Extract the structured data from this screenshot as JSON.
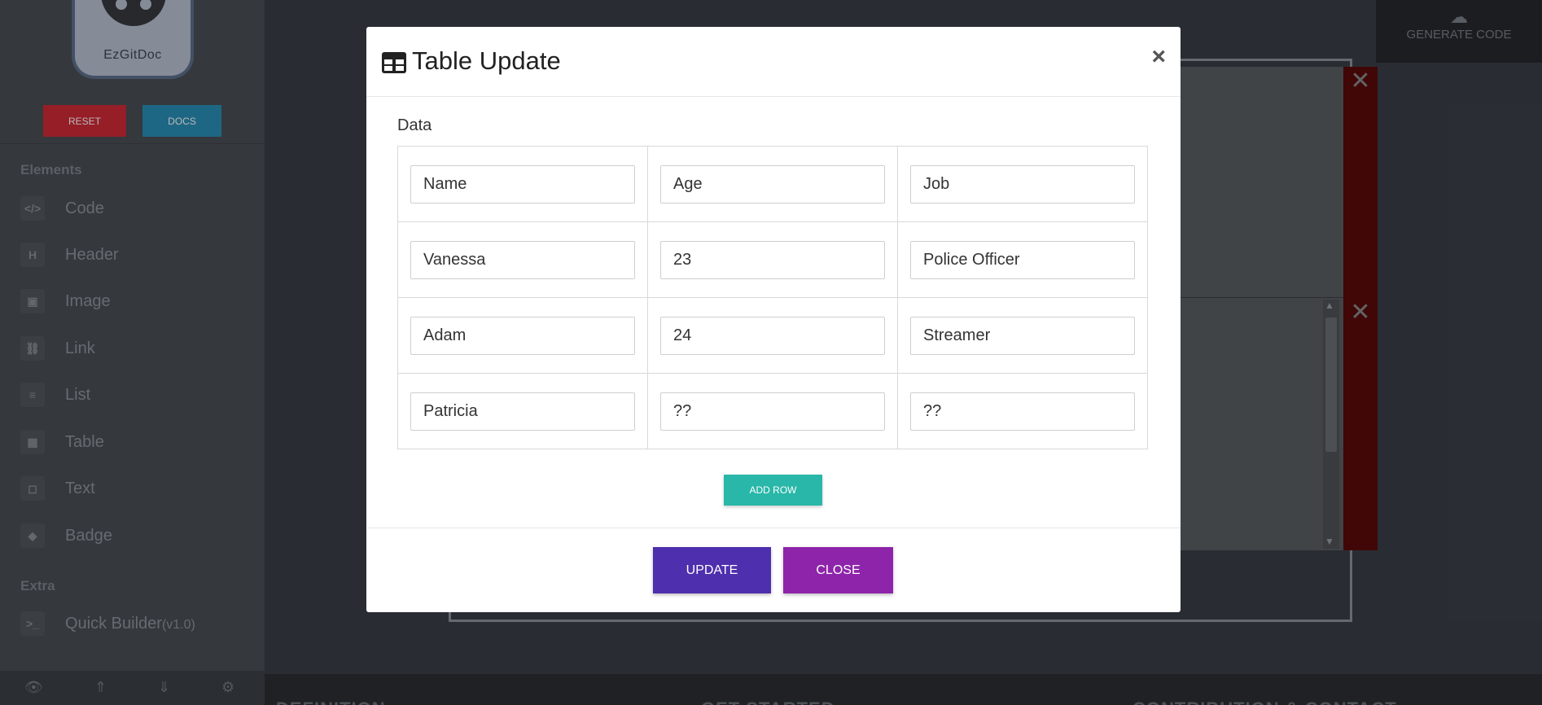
{
  "sidebar": {
    "logo_text": "EzGitDoc",
    "reset_label": "RESET",
    "docs_label": "DOCS",
    "elements_heading": "Elements",
    "items": [
      {
        "label": "Code",
        "icon": "code-icon",
        "glyph": "</>"
      },
      {
        "label": "Header",
        "icon": "header-icon",
        "glyph": "H"
      },
      {
        "label": "Image",
        "icon": "image-icon",
        "glyph": "▣"
      },
      {
        "label": "Link",
        "icon": "link-icon",
        "glyph": "⛓"
      },
      {
        "label": "List",
        "icon": "list-icon",
        "glyph": "≡"
      },
      {
        "label": "Table",
        "icon": "table-icon",
        "glyph": "▦"
      },
      {
        "label": "Text",
        "icon": "text-icon",
        "glyph": "◻"
      },
      {
        "label": "Badge",
        "icon": "badge-icon",
        "glyph": "◆"
      }
    ],
    "extra_heading": "Extra",
    "quick_builder": {
      "label": "Quick Builder",
      "version": "(v1.0)",
      "icon": "terminal-icon",
      "glyph": ">_"
    },
    "footer_icons": [
      "eye-icon",
      "collapse-up-icon",
      "collapse-down-icon",
      "gear-icon"
    ]
  },
  "generate_code": {
    "label": "GENERATE CODE",
    "icon": "cloud-code-icon"
  },
  "bottom_sections": [
    "DEFINITION",
    "GET STARTED",
    "CONTRIBUTION & CONTACT"
  ],
  "modal": {
    "title": "Table Update",
    "title_icon": "table-icon",
    "close_glyph": "×",
    "data_label": "Data",
    "rows": [
      [
        "Name",
        "Age",
        "Job"
      ],
      [
        "Vanessa",
        "23",
        "Police Officer"
      ],
      [
        "Adam",
        "24",
        "Streamer"
      ],
      [
        "Patricia",
        "??",
        "??"
      ]
    ],
    "add_row_label": "ADD ROW",
    "update_label": "UPDATE",
    "close_label": "CLOSE"
  },
  "colors": {
    "reset": "#cf2a36",
    "docs": "#2a8fb8",
    "add_row": "#28b7a8",
    "update": "#4e2fad",
    "close": "#8e24aa",
    "delete_strip": "#5a0a0a"
  }
}
